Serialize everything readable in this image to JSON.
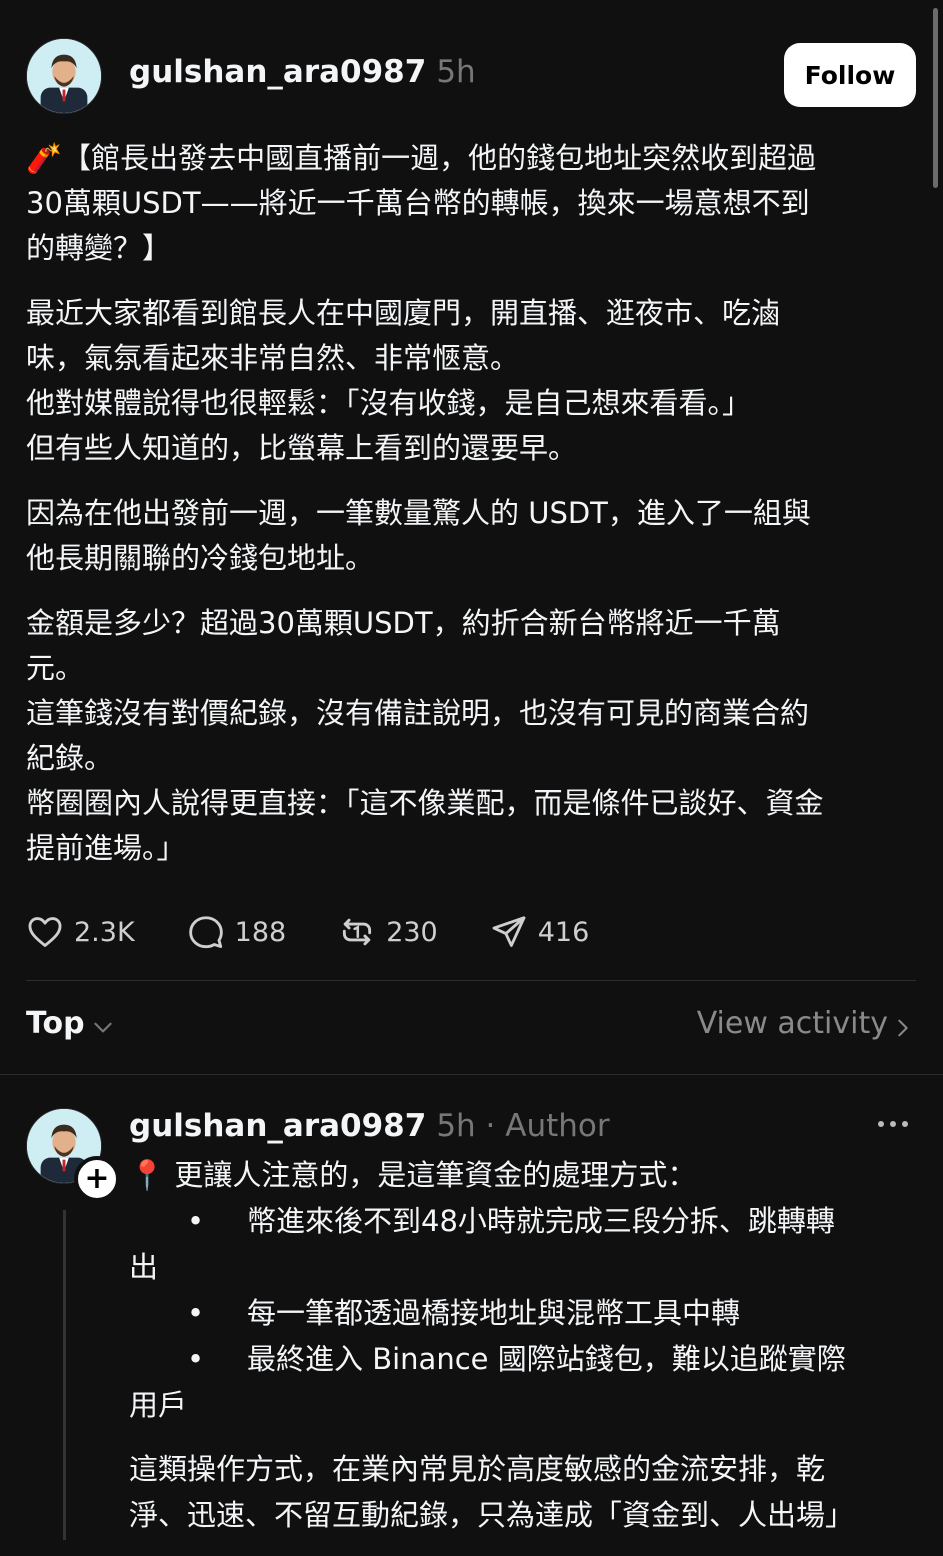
{
  "post": {
    "username": "gulshan_ara0987",
    "time": "5h",
    "follow_label": "Follow",
    "paragraphs": [
      [
        "🧨【館長出發去中國直播前一週，他的錢包地址突然收到超過",
        "30萬顆USDT——將近一千萬台幣的轉帳，換來一場意想不到",
        "的轉變？】"
      ],
      [
        "最近大家都看到館長人在中國廈門，開直播、逛夜市、吃滷",
        "味，氣氛看起來非常自然、非常愜意。",
        "他對媒體說得也很輕鬆：「沒有收錢，是自己想來看看。」",
        "但有些人知道的，比螢幕上看到的還要早。"
      ],
      [
        "因為在他出發前一週，一筆數量驚人的 USDT，進入了一組與",
        "他長期關聯的冷錢包地址。"
      ],
      [
        "金額是多少？超過30萬顆USDT，約折合新台幣將近一千萬",
        "元。",
        "這筆錢沒有對價紀錄，沒有備註說明，也沒有可見的商業合約",
        "紀錄。",
        "幣圈圈內人說得更直接：「這不像業配，而是條件已談好、資金",
        "提前進場。」"
      ]
    ],
    "stats": {
      "likes": "2.3K",
      "comments": "188",
      "reposts": "230",
      "shares": "416"
    }
  },
  "sort": {
    "label": "Top",
    "view_activity": "View activity"
  },
  "reply": {
    "username": "gulshan_ara0987",
    "meta": "5h · Author",
    "intro": "📍 更讓人注意的，是這筆資金的處理方式：",
    "bullets": [
      [
        "•",
        "幣進來後不到48小時就完成三段分拆、跳轉轉",
        "出"
      ],
      [
        "•",
        "每一筆都透過橋接地址與混幣工具中轉",
        ""
      ],
      [
        "•",
        "最終進入 Binance 國際站錢包，難以追蹤實際",
        "用戶"
      ]
    ],
    "closing": [
      "這類操作方式，在業內常見於高度敏感的金流安排，乾",
      "淨、迅速、不留互動紀錄，只為達成「資金到、人出場」"
    ]
  },
  "icons": {
    "like": "heart-icon",
    "comment": "comment-bubble-icon",
    "repost": "repost-arrows-icon",
    "share": "send-icon",
    "more": "more-dots-icon"
  }
}
